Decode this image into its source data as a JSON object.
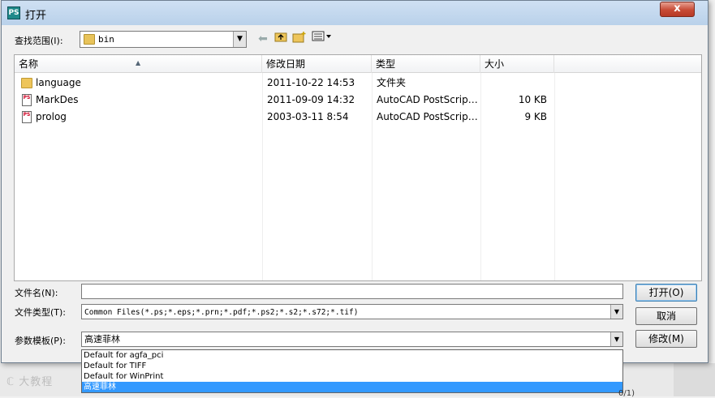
{
  "dialog": {
    "title": "打开",
    "app_icon_text": "PS",
    "close_symbol": "x"
  },
  "lookin": {
    "label": "查找范围(I):",
    "value": "bin"
  },
  "toolbar_icons": [
    "back-arrow-icon",
    "up-folder-icon",
    "new-folder-icon",
    "view-menu-icon"
  ],
  "columns": [
    "名称",
    "修改日期",
    "类型",
    "大小"
  ],
  "files": [
    {
      "name": "language",
      "date": "2011-10-22 14:53",
      "type": "文件夹",
      "size": "",
      "icon": "folder-icon"
    },
    {
      "name": "MarkDes",
      "date": "2011-09-09 14:32",
      "type": "AutoCAD PostScrip…",
      "size": "10 KB",
      "icon": "ps-file-icon"
    },
    {
      "name": "prolog",
      "date": "2003-03-11 8:54",
      "type": "AutoCAD PostScrip…",
      "size": "9 KB",
      "icon": "ps-file-icon"
    }
  ],
  "filename": {
    "label": "文件名(N):",
    "value": ""
  },
  "filetype": {
    "label": "文件类型(T):",
    "value": "Common Files(*.ps;*.eps;*.prn;*.pdf;*.ps2;*.s2;*.s72;*.tif)"
  },
  "template": {
    "label": "参数模板(P):",
    "value": "高速菲林",
    "options": [
      "Default for agfa_pci",
      "Default for TIFF",
      "Default for WinPrint",
      "高速菲林"
    ],
    "selected_index": 3
  },
  "buttons": {
    "open": "打开(O)",
    "cancel": "取消",
    "modify": "修改(M)"
  },
  "watermark": "大教程",
  "status_fragment": "0/1)"
}
